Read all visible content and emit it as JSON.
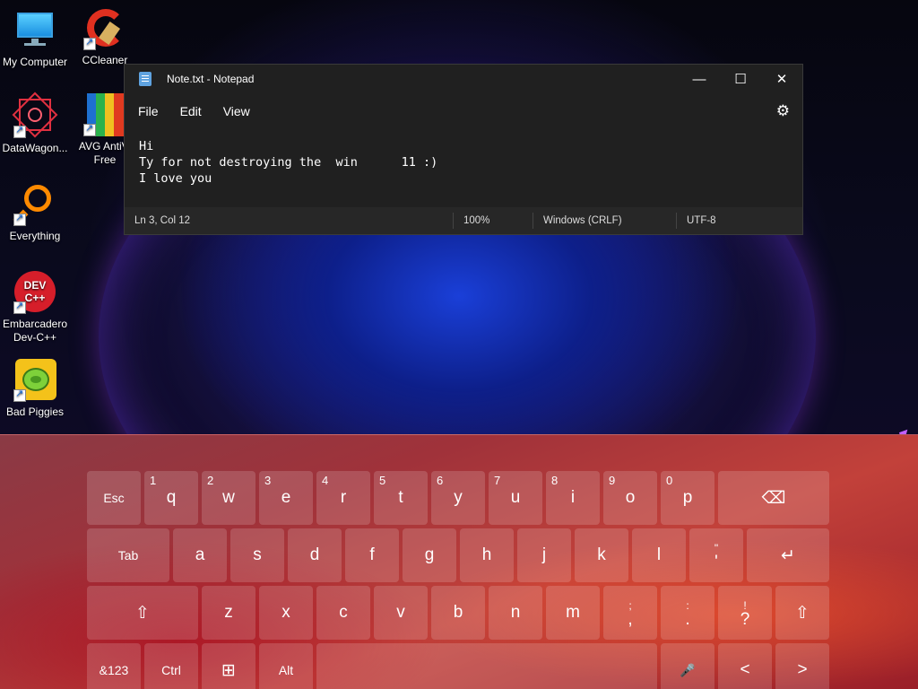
{
  "desktop": {
    "icons": [
      {
        "label": "My Computer"
      },
      {
        "label": "CCleaner"
      },
      {
        "label": "DataWagon..."
      },
      {
        "label": "AVG AntiVi Free"
      },
      {
        "label": "Everything"
      },
      {
        "label": "Embarcadero Dev-C++"
      },
      {
        "label": "Bad Piggies"
      }
    ],
    "icon_glyphs": {
      "dev": "DEV C++"
    }
  },
  "notepad": {
    "title": "Note.txt - Notepad",
    "window_buttons": {
      "minimize": "—",
      "maximize": "☐",
      "close": "✕"
    },
    "menu": [
      "File",
      "Edit",
      "View"
    ],
    "settings_icon": "⚙",
    "content": "Hi\nTy for not destroying the  win      11 :)\nI love you",
    "status": {
      "position": "Ln 3, Col 12",
      "zoom": "100%",
      "line_ending": "Windows (CRLF)",
      "encoding": "UTF-8"
    }
  },
  "keyboard": {
    "row1": {
      "esc": "Esc",
      "letters": [
        "q",
        "w",
        "e",
        "r",
        "t",
        "y",
        "u",
        "i",
        "o",
        "p"
      ],
      "numbers": [
        "1",
        "2",
        "3",
        "4",
        "5",
        "6",
        "7",
        "8",
        "9",
        "0"
      ],
      "backspace": "⌫"
    },
    "row2": {
      "tab": "Tab",
      "letters": [
        "a",
        "s",
        "d",
        "f",
        "g",
        "h",
        "j",
        "k",
        "l"
      ],
      "quote_top": "\"",
      "quote_bottom": "'",
      "enter": "↵"
    },
    "row3": {
      "shift": "⇧",
      "letters": [
        "z",
        "x",
        "c",
        "v",
        "b",
        "n",
        "m"
      ],
      "comma_top": ";",
      "comma_bottom": ",",
      "period_top": ":",
      "period_bottom": ".",
      "question_top": "!",
      "question_bottom": "?"
    },
    "row4": {
      "sym": "&123",
      "ctrl": "Ctrl",
      "win": "⊞",
      "alt": "Alt",
      "mic": "🎤",
      "left": "<",
      "right": ">"
    }
  }
}
